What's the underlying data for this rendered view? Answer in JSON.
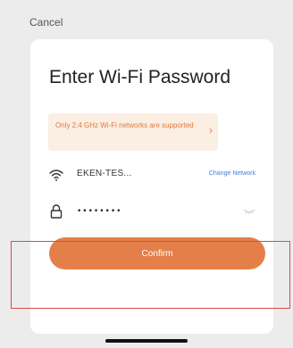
{
  "header": {
    "cancel_label": "Cancel"
  },
  "dialog": {
    "title": "Enter Wi-Fi Password",
    "notice": "Only 2.4 GHz Wi-Fi networks are supported",
    "network": {
      "ssid": "EKEN-TES...",
      "change_label": "Change Network",
      "icon": "wifi-icon"
    },
    "password": {
      "value": "••••••••",
      "icon": "lock-icon",
      "toggle_icon": "eye-closed-icon"
    },
    "confirm_label": "Confirm"
  },
  "colors": {
    "accent": "#e47f49",
    "notice_bg": "#fbeee3",
    "notice_text": "#e07a3f",
    "link": "#4a7bd0",
    "highlight_border": "#e0484b"
  }
}
